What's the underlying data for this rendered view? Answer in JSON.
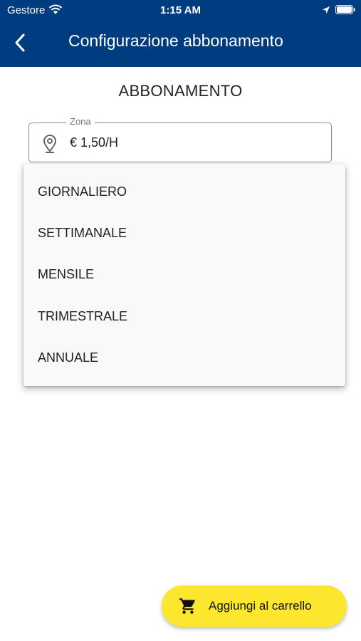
{
  "status_bar": {
    "carrier": "Gestore",
    "time": "1:15 AM"
  },
  "header": {
    "title": "Configurazione abbonamento",
    "back_icon": "chevron-left-icon",
    "background_color": "#003d80"
  },
  "section": {
    "title": "ABBONAMENTO"
  },
  "zone_field": {
    "label": "Zona",
    "value": "€ 1,50/H",
    "icon": "location-pin-icon"
  },
  "dropdown": {
    "items": [
      {
        "label": "GIORNALIERO"
      },
      {
        "label": "SETTIMANALE"
      },
      {
        "label": "MENSILE"
      },
      {
        "label": "TRIMESTRALE"
      },
      {
        "label": "ANNUALE"
      }
    ]
  },
  "cart_button": {
    "label": "Aggiungi al carrello",
    "icon": "shopping-cart-icon",
    "color": "#fce62e"
  }
}
